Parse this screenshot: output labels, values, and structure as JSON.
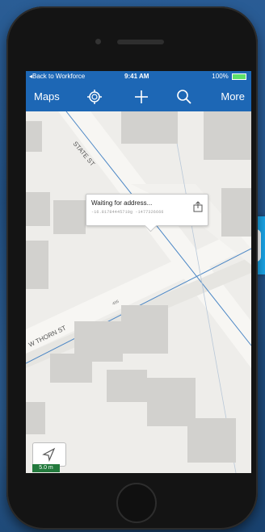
{
  "status_bar": {
    "back_label": "Back to Workforce",
    "time": "9:41 AM",
    "battery": "100%"
  },
  "nav": {
    "maps_label": "Maps",
    "more_label": "More",
    "icons": [
      "location-target-icon",
      "plus-icon",
      "search-icon"
    ]
  },
  "map": {
    "streets": [
      "STATE ST",
      "W THORN ST"
    ],
    "small_label": "485"
  },
  "callout": {
    "title": "Waiting for address...",
    "coords": "-16.81784445710g -1477326666"
  },
  "scale": {
    "label": "5.0 m"
  },
  "colors": {
    "nav_blue": "#1d67b5",
    "scale_green": "#237a3d",
    "side_logo": "#1aa6ea"
  }
}
